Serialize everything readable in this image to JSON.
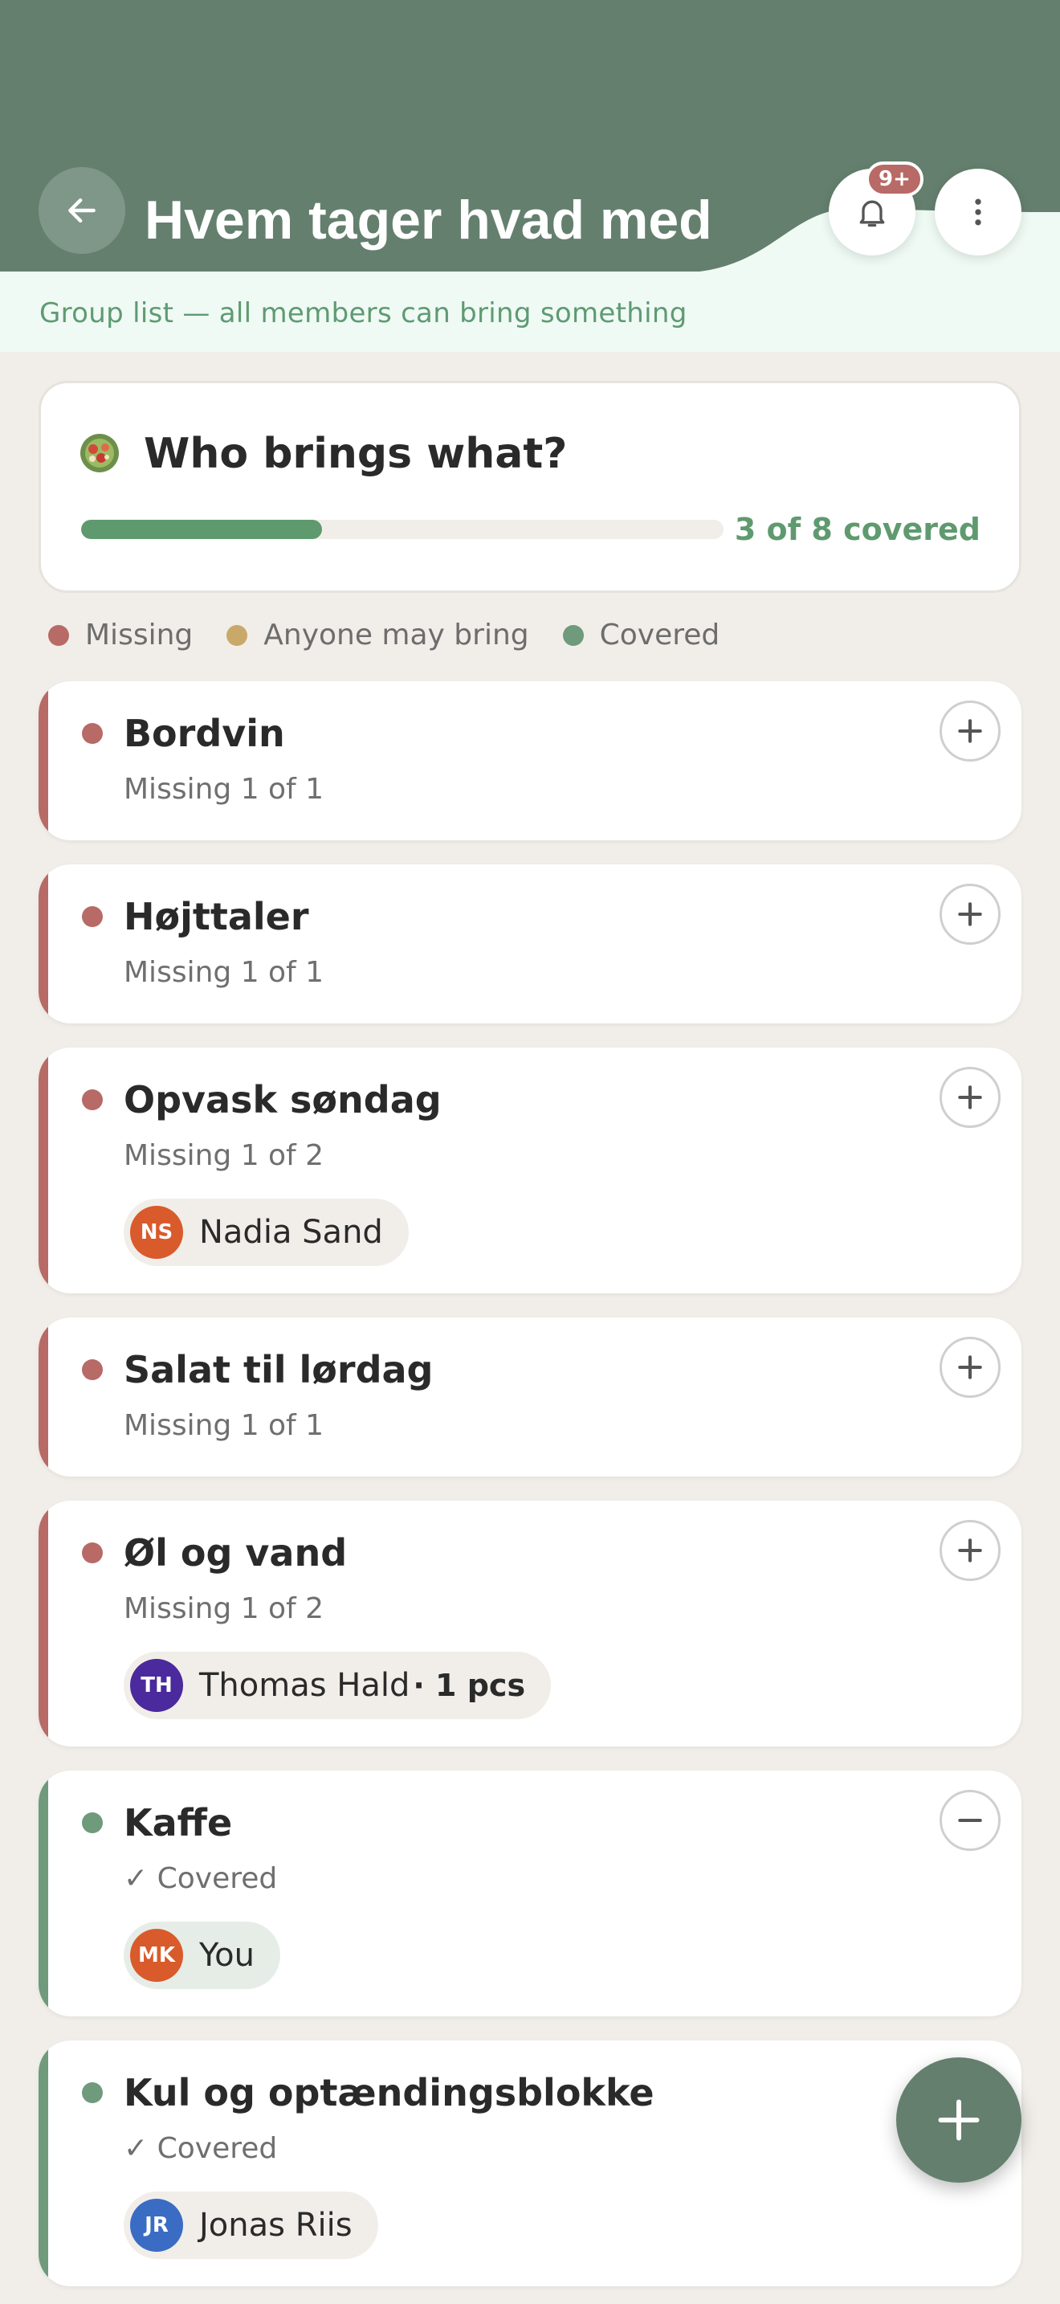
{
  "header": {
    "title": "Hvem tager hvad med",
    "subtitle": "Group list — all members can bring something",
    "notification_badge": "9+",
    "accent_color": "#647f6e"
  },
  "summary": {
    "title": "Who brings what?",
    "icon": "salad-bowl-icon",
    "progress_fraction": 0.375,
    "progress_text": "3 of 8 covered"
  },
  "legend": [
    {
      "label": "Missing",
      "color": "#b86a66"
    },
    {
      "label": "Anyone may bring",
      "color": "#c9a86a"
    },
    {
      "label": "Covered",
      "color": "#6f9a7c"
    }
  ],
  "items": [
    {
      "name": "Bordvin",
      "status_text": "Missing 1 of 1",
      "state": "missing",
      "action": "add"
    },
    {
      "name": "Højttaler",
      "status_text": "Missing 1 of 1",
      "state": "missing",
      "action": "add"
    },
    {
      "name": "Opvask søndag",
      "status_text": "Missing 1 of 2",
      "state": "missing",
      "action": "add",
      "bringer": {
        "initials": "NS",
        "name": "Nadia Sand",
        "avatar_color": "#d95a2b"
      }
    },
    {
      "name": "Salat til lørdag",
      "status_text": "Missing 1 of 1",
      "state": "missing",
      "action": "add"
    },
    {
      "name": "Øl og vand",
      "status_text": "Missing 1 of 2",
      "state": "missing",
      "action": "add",
      "bringer": {
        "initials": "TH",
        "name": "Thomas Hald",
        "qty": "· 1 pcs",
        "avatar_color": "#4a2a9c"
      }
    },
    {
      "name": "Kaffe",
      "status_text": "✓ Covered",
      "state": "covered",
      "action": "remove",
      "bringer": {
        "initials": "MK",
        "name": "You",
        "avatar_color": "#d95a2b"
      }
    },
    {
      "name": "Kul og optændingsblokke",
      "status_text": "✓ Covered",
      "state": "covered",
      "action": "none",
      "bringer": {
        "initials": "JR",
        "name": "Jonas Riis",
        "avatar_color": "#3a6cc4"
      }
    }
  ]
}
